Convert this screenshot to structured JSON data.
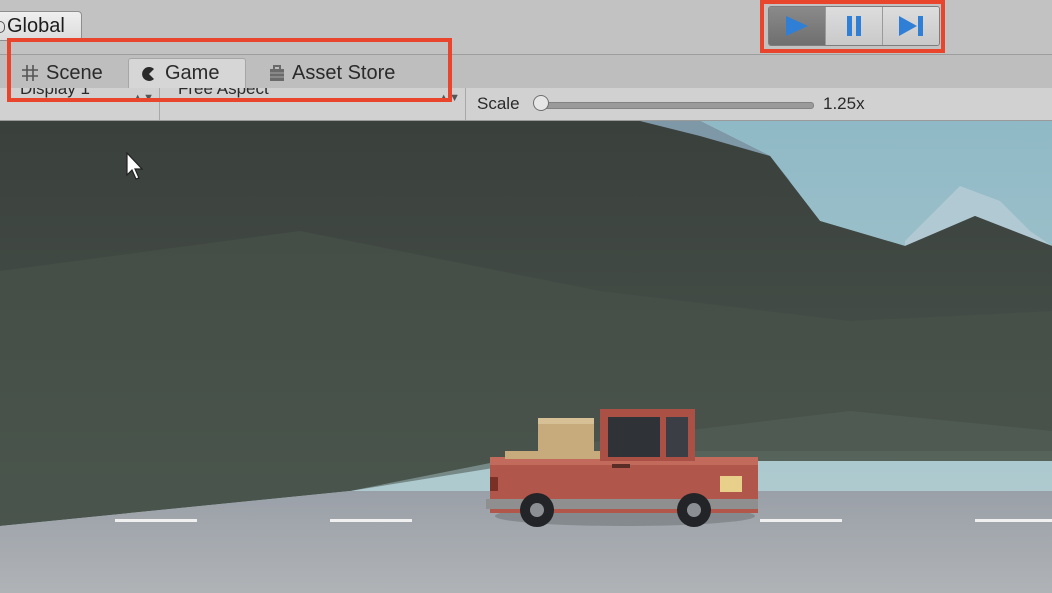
{
  "toolbar": {
    "global_label": "Global",
    "play_controls": [
      {
        "name": "play",
        "icon": "play-icon",
        "active": true
      },
      {
        "name": "pause",
        "icon": "pause-icon",
        "active": false
      },
      {
        "name": "step",
        "icon": "step-icon",
        "active": false
      }
    ]
  },
  "tabs": [
    {
      "label": "Scene",
      "icon": "grid-icon",
      "active": false
    },
    {
      "label": "Game",
      "icon": "pacman-icon",
      "active": true
    },
    {
      "label": "Asset Store",
      "icon": "bag-icon",
      "active": false
    }
  ],
  "game_toolbar": {
    "display": "Display 1",
    "aspect": "Free Aspect",
    "scale_label": "Scale",
    "scale_value": "1.25x",
    "scale_level": 0.0
  },
  "highlight_color": "#e8452c",
  "accent_color": "#2f7fd6"
}
